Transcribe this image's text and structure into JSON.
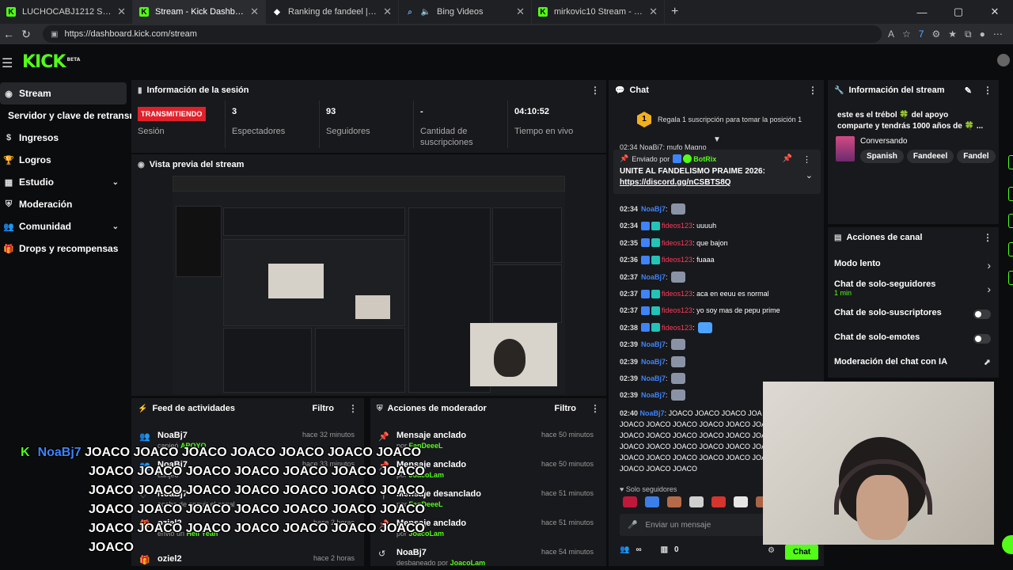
{
  "browser": {
    "tabs": [
      {
        "label": "LUCHOCABJ1212 Stream - Watch L",
        "icon": "kick-favicon"
      },
      {
        "label": "Stream - Kick Dashboard",
        "icon": "kick-favicon"
      },
      {
        "label": "Ranking de fandeel | El mejor sol",
        "icon": "diamond-favicon"
      },
      {
        "label": "Bing Videos",
        "icon": "bing-favicon"
      },
      {
        "label": "mirkovic10 Stream - Watch Live o",
        "icon": "kick-favicon"
      }
    ],
    "url": "https://dashboard.kick.com/stream"
  },
  "kick": {
    "logo": "KICK",
    "beta": "BETA"
  },
  "sidebar": {
    "items": [
      {
        "label": "Stream"
      },
      {
        "label": "Servidor y clave de retransmisión"
      },
      {
        "label": "Ingresos"
      },
      {
        "label": "Logros"
      },
      {
        "label": "Estudio"
      },
      {
        "label": "Moderación"
      },
      {
        "label": "Comunidad"
      },
      {
        "label": "Drops y recompensas"
      }
    ]
  },
  "session": {
    "title": "Información de la sesión",
    "live_badge": "TRANSMITIENDO",
    "stats": [
      {
        "value": "",
        "label": "Sesión"
      },
      {
        "value": "3",
        "label": "Espectadores"
      },
      {
        "value": "93",
        "label": "Seguidores"
      },
      {
        "value": "-",
        "label": "Cantidad de suscripciones"
      },
      {
        "value": "04:10:52",
        "label": "Tiempo en vivo"
      }
    ]
  },
  "preview": {
    "title": "Vista previa del stream"
  },
  "feed": {
    "title": "Feed de actividades",
    "filter": "Filtro",
    "rows": [
      {
        "name": "NoaBj7",
        "sub": "canjeó",
        "sub_highlight": "APOYO",
        "time": "hace 32 minutos"
      },
      {
        "name": "NoaBj7",
        "sub": "canjeó",
        "sub_highlight": "",
        "time": "hace 33 minutos"
      },
      {
        "name": "NoaBj7",
        "sub": "acaba de seguir el canal",
        "sub_highlight": "",
        "time": ""
      },
      {
        "name": "oziel2",
        "sub": "envió un",
        "sub_highlight": "Hell Yeah",
        "time": "hace 2 horas"
      },
      {
        "name": "oziel2",
        "sub": "",
        "sub_highlight": "",
        "time": "hace 2 horas"
      }
    ]
  },
  "modactions": {
    "title": "Acciones de moderador",
    "filter": "Filtro",
    "rows": [
      {
        "action": "Mensaje anclado",
        "by": "por",
        "who": "FanDeeeL",
        "time": "hace 50 minutos"
      },
      {
        "action": "Mensaje anclado",
        "by": "por",
        "who": "JoacoLam",
        "time": "hace 50 minutos"
      },
      {
        "action": "Mensaje desanclado",
        "by": "por",
        "who": "FanDeeeL",
        "time": "hace 51 minutos"
      },
      {
        "action": "Mensaje anclado",
        "by": "por",
        "who": "JoacoLam",
        "time": "hace 51 minutos"
      },
      {
        "action": "NoaBj7",
        "by": "desbaneado por",
        "who": "JoacoLam",
        "time": "hace 54 minutos"
      }
    ]
  },
  "chat": {
    "title": "Chat",
    "goal_rank": "1",
    "goal_text": "Regala 1 suscripción para tomar la posición 1",
    "pinned_by_label": "Enviado por",
    "pinned_by": "BotRix",
    "pinned_text": "UNITE AL FANDELISMO PRAIME 2026:",
    "pinned_link": "https://discord.gg/nCSBTS8Q",
    "partial_top": "02:34 NoaBj7: mufo Magno",
    "messages": [
      {
        "time": "02:34",
        "user": "NoaBj7",
        "color": "blue",
        "text": ":",
        "emote": true
      },
      {
        "time": "02:34",
        "user": "fideos123",
        "color": "red",
        "text": ": uuuuh",
        "emote": false
      },
      {
        "time": "02:35",
        "user": "fideos123",
        "color": "red",
        "text": ": que bajon",
        "emote": false
      },
      {
        "time": "02:36",
        "user": "fideos123",
        "color": "red",
        "text": ": fuaaa",
        "emote": false
      },
      {
        "time": "02:37",
        "user": "NoaBj7",
        "color": "blue",
        "text": ":",
        "emote": true
      },
      {
        "time": "02:37",
        "user": "fideos123",
        "color": "red",
        "text": ": aca en eeuu es normal",
        "emote": false
      },
      {
        "time": "02:37",
        "user": "fideos123",
        "color": "red",
        "text": ": yo soy mas de pepu prime",
        "emote": false
      },
      {
        "time": "02:38",
        "user": "fideos123",
        "color": "red",
        "text": ":",
        "emote": true
      },
      {
        "time": "02:39",
        "user": "NoaBj7",
        "color": "blue",
        "text": ":",
        "emote": true
      },
      {
        "time": "02:39",
        "user": "NoaBj7",
        "color": "blue",
        "text": ":",
        "emote": true
      },
      {
        "time": "02:39",
        "user": "NoaBj7",
        "color": "blue",
        "text": ":",
        "emote": true
      },
      {
        "time": "02:39",
        "user": "NoaBj7",
        "color": "blue",
        "text": ":",
        "emote": true
      }
    ],
    "long_msg_time": "02:40",
    "long_msg_user": "NoaBj7",
    "long_msg_lines": [
      ": JOACO JOACO JOACO JOA",
      "JOACO JOACO JOACO JOACO JOACO JOACO JOA",
      "JOACO JOACO JOACO JOACO JOACO JOACO JOA",
      "JOACO JOACO JOACO JOACO JOACO JOACO JOA",
      "JOACO JOACO JOACO JOACO JOACO JOACO JOA",
      "JOACO JOACO JOACO"
    ],
    "mode": "Solo seguidores",
    "input_placeholder": "Enviar un mensaje",
    "viewers_count": "0",
    "send_label": "Chat"
  },
  "streaminfo": {
    "title": "Información del stream",
    "desc_line1": "este es el trébol 🍀 del apoyo",
    "desc_line2": "comparte y tendrás 1000 años de 🍀 ...",
    "category": "Conversando",
    "tags": [
      "Spanish",
      "Fandeeel",
      "Fandel"
    ]
  },
  "channel_actions": {
    "title": "Acciones de canal",
    "items": [
      {
        "label": "Modo lento",
        "sub": "",
        "control": "arrow"
      },
      {
        "label": "Chat de solo-seguidores",
        "sub": "1 min",
        "control": "arrow"
      },
      {
        "label": "Chat de solo-suscriptores",
        "sub": "",
        "control": "toggle"
      },
      {
        "label": "Chat de solo-emotes",
        "sub": "",
        "control": "toggle"
      },
      {
        "label": "Moderación del chat con IA",
        "sub": "",
        "control": "external"
      }
    ]
  },
  "overlay": {
    "name": "NoaBj7",
    "lines": [
      "JOACO JOACO JOACO JOACO JOACO JOACO JOACO",
      "JOACO JOACO JOACO JOACO JOACO JOACO JOACO",
      "JOACO JOACO JOACO JOACO JOACO JOACO JOACO",
      "JOACO JOACO JOACO JOACO JOACO JOACO JOACO",
      "JOACO JOACO JOACO JOACO JOACO JOACO JOACO",
      "JOACO"
    ]
  },
  "colors": {
    "accent": "#53fc18",
    "live": "#e0212b",
    "panel": "#18191c",
    "user_blue": "#3f83f8",
    "user_red": "#ff3b5c"
  }
}
